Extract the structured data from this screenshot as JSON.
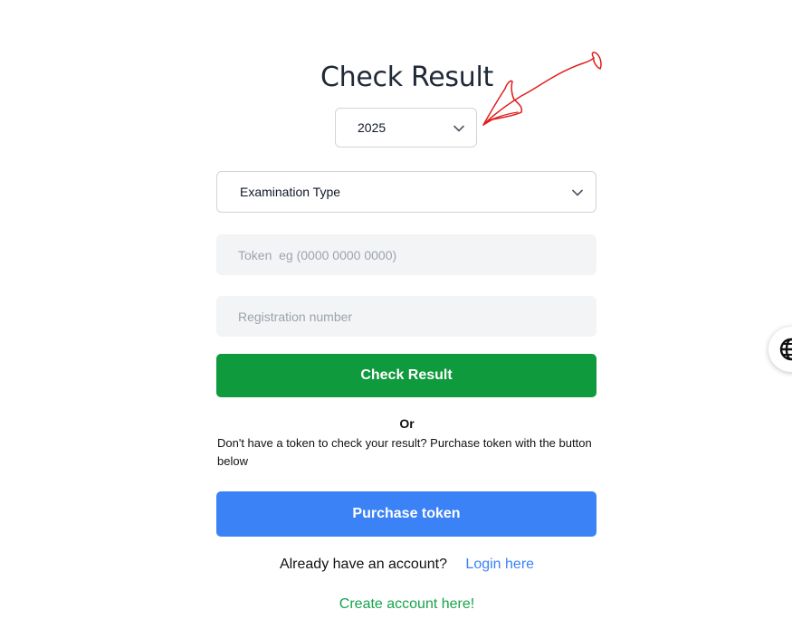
{
  "page": {
    "title": "Check Result"
  },
  "form": {
    "year_select": {
      "selected": "2025",
      "icon": "chevron-down-icon"
    },
    "exam_type_select": {
      "selected": "Examination Type",
      "icon": "chevron-down-icon"
    },
    "token_input": {
      "value": "",
      "placeholder": "Token  eg (0000 0000 0000)"
    },
    "registration_input": {
      "value": "",
      "placeholder": "Registration number"
    },
    "check_button_label": "Check Result"
  },
  "alternate": {
    "or_label": "Or",
    "hint": "Don't have a token to check your result? Purchase token with the button below",
    "purchase_button_label": "Purchase token"
  },
  "account": {
    "prompt": "Already have an account?",
    "login_link": "Login here",
    "create_link": "Create account here!"
  },
  "overlay": {
    "annotation": "red-hand-drawn-arrow",
    "side_widget_icon": "globe-icon"
  },
  "colors": {
    "primary_green": "#0f9a3d",
    "primary_blue": "#3b82f6",
    "link_green": "#16a34a",
    "annotation_red": "#e11d1d"
  }
}
